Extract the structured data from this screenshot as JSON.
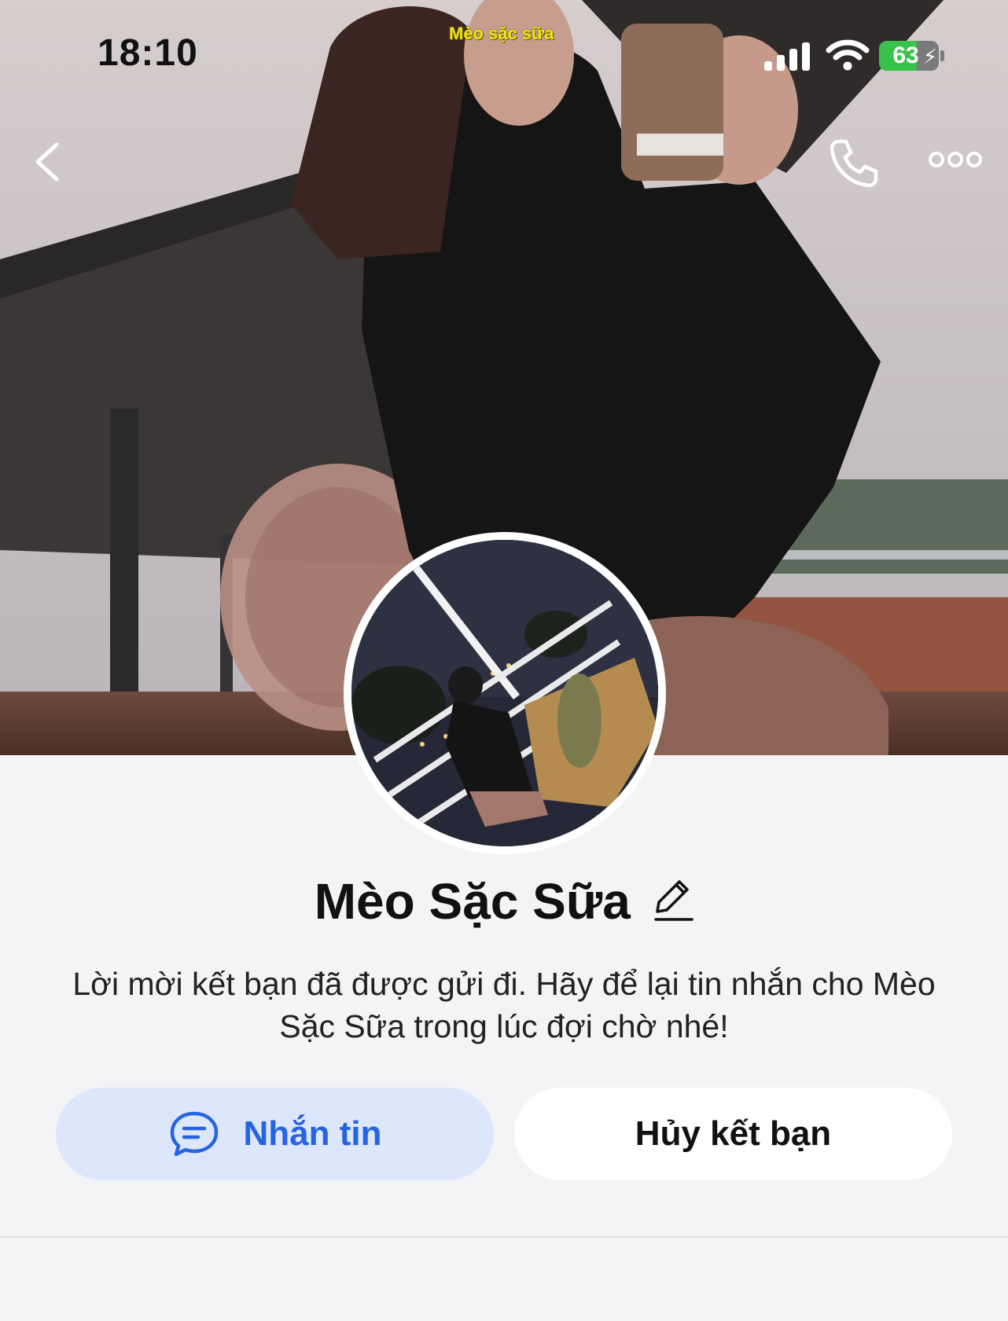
{
  "status_bar": {
    "time": "18:10",
    "center_label": "Mèo sặc sữa",
    "battery_percent": 63,
    "battery_charging": true,
    "icons": [
      "signal-icon",
      "wifi-icon",
      "battery-icon"
    ]
  },
  "nav": {
    "icons": [
      "back-chevron-icon",
      "phone-icon",
      "more-dots-icon"
    ]
  },
  "profile": {
    "name": "Mèo Sặc Sữa",
    "edit_icon": "pencil-icon"
  },
  "friend_request": {
    "message": "Lời mời kết bạn đã được gửi đi. Hãy để lại tin nhắn cho Mèo Sặc Sữa trong lúc đợi chờ nhé!"
  },
  "actions": {
    "message_label": "Nhắn tin",
    "message_icon": "chat-bubble-icon",
    "unfriend_label": "Hủy kết bạn"
  },
  "colors": {
    "accent_blue": "#2764e4",
    "message_button_bg": "#dde7fb",
    "page_bg": "#f4f4f7",
    "battery_green": "#39c24a"
  }
}
